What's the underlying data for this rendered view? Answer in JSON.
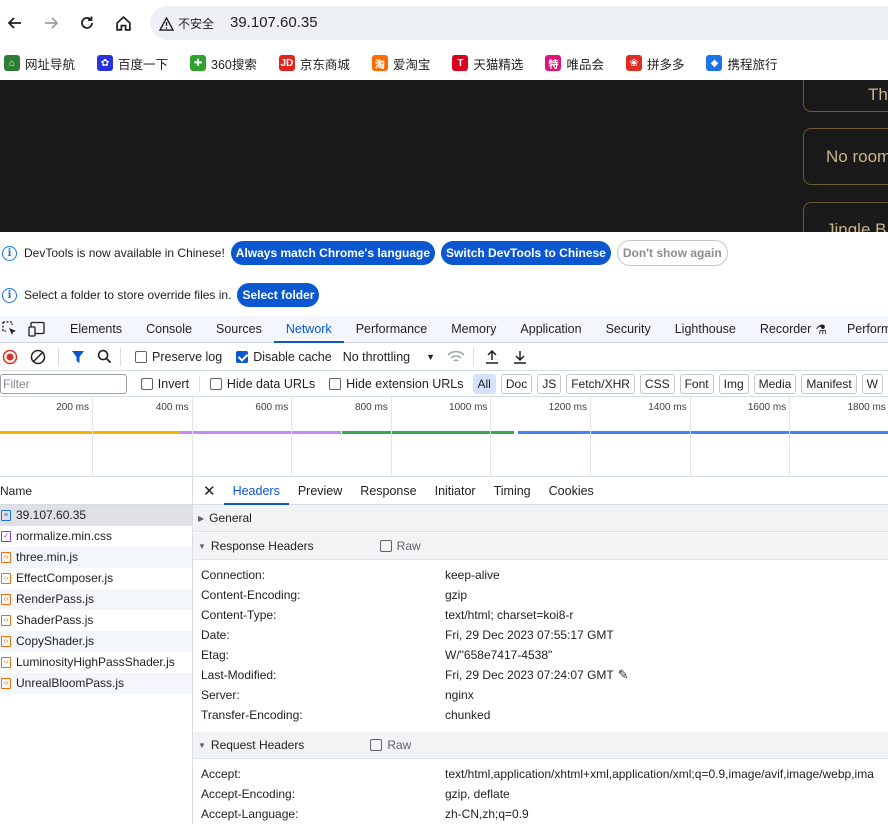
{
  "browser": {
    "security_label": "不安全",
    "url": "39.107.60.35"
  },
  "bookmarks": [
    {
      "label": "网址导航",
      "icon": "home-icon",
      "color": "#2e7d32"
    },
    {
      "label": "百度一下",
      "icon": "baidu-paw-icon",
      "color": "#2932e1"
    },
    {
      "label": "360搜索",
      "icon": "search360-icon",
      "color": "#2ea12e"
    },
    {
      "label": "京东商城",
      "icon": "jd-icon",
      "color": "#e1251b"
    },
    {
      "label": "爱淘宝",
      "icon": "taobao-icon",
      "color": "#ff6a00"
    },
    {
      "label": "天猫精选",
      "icon": "tmall-icon",
      "color": "#d9001b"
    },
    {
      "label": "唯品会",
      "icon": "vip-icon",
      "color": "#e1127a"
    },
    {
      "label": "拼多多",
      "icon": "pdd-icon",
      "color": "#e02e24"
    },
    {
      "label": "携程旅行",
      "icon": "ctrip-icon",
      "color": "#1a73e8"
    }
  ],
  "page": {
    "cards": [
      "Thi",
      "No room",
      "Jingle B"
    ]
  },
  "infobar1": {
    "message": "DevTools is now available in Chinese!",
    "btn1": "Always match Chrome's language",
    "btn2": "Switch DevTools to Chinese",
    "btn3": "Don't show again"
  },
  "infobar2": {
    "message": "Select a folder to store override files in.",
    "btn": "Select folder"
  },
  "devtools": {
    "tabs": [
      "Elements",
      "Console",
      "Sources",
      "Network",
      "Performance",
      "Memory",
      "Application",
      "Security",
      "Lighthouse",
      "Recorder",
      "Performa"
    ],
    "active_tab": "Network"
  },
  "toolbar": {
    "preserve_log": "Preserve log",
    "disable_cache": "Disable cache",
    "throttling": "No throttling"
  },
  "filter": {
    "placeholder": "Filter",
    "invert": "Invert",
    "hide_data_urls": "Hide data URLs",
    "hide_extension_urls": "Hide extension URLs",
    "chips": [
      "All",
      "Doc",
      "JS",
      "Fetch/XHR",
      "CSS",
      "Font",
      "Img",
      "Media",
      "Manifest",
      "W"
    ]
  },
  "overview": {
    "ticks": [
      "200 ms",
      "400 ms",
      "600 ms",
      "800 ms",
      "1000 ms",
      "1200 ms",
      "1400 ms",
      "1600 ms",
      "1800 ms"
    ]
  },
  "requests": {
    "header": "Name",
    "items": [
      {
        "name": "39.107.60.35",
        "type": "document"
      },
      {
        "name": "normalize.min.css",
        "type": "stylesheet"
      },
      {
        "name": "three.min.js",
        "type": "script"
      },
      {
        "name": "EffectComposer.js",
        "type": "script"
      },
      {
        "name": "RenderPass.js",
        "type": "script"
      },
      {
        "name": "ShaderPass.js",
        "type": "script"
      },
      {
        "name": "CopyShader.js",
        "type": "script"
      },
      {
        "name": "LuminosityHighPassShader.js",
        "type": "script"
      },
      {
        "name": "UnrealBloomPass.js",
        "type": "script"
      }
    ]
  },
  "detail": {
    "tabs": [
      "Headers",
      "Preview",
      "Response",
      "Initiator",
      "Timing",
      "Cookies"
    ],
    "active_tab": "Headers",
    "general": "General",
    "response_headers_title": "Response Headers",
    "raw": "Raw",
    "response_headers": [
      {
        "k": "Connection:",
        "v": "keep-alive"
      },
      {
        "k": "Content-Encoding:",
        "v": "gzip"
      },
      {
        "k": "Content-Type:",
        "v": "text/html; charset=koi8-r"
      },
      {
        "k": "Date:",
        "v": "Fri, 29 Dec 2023 07:55:17 GMT"
      },
      {
        "k": "Etag:",
        "v": "W/\"658e7417-4538\""
      },
      {
        "k": "Last-Modified:",
        "v": "Fri, 29 Dec 2023 07:24:07 GMT"
      },
      {
        "k": "Server:",
        "v": "nginx"
      },
      {
        "k": "Transfer-Encoding:",
        "v": "chunked"
      }
    ],
    "request_headers_title": "Request Headers",
    "request_headers": [
      {
        "k": "Accept:",
        "v": "text/html,application/xhtml+xml,application/xml;q=0.9,image/avif,image/webp,ima"
      },
      {
        "k": "Accept-Encoding:",
        "v": "gzip, deflate"
      },
      {
        "k": "Accept-Language:",
        "v": "zh-CN,zh;q=0.9"
      }
    ]
  }
}
